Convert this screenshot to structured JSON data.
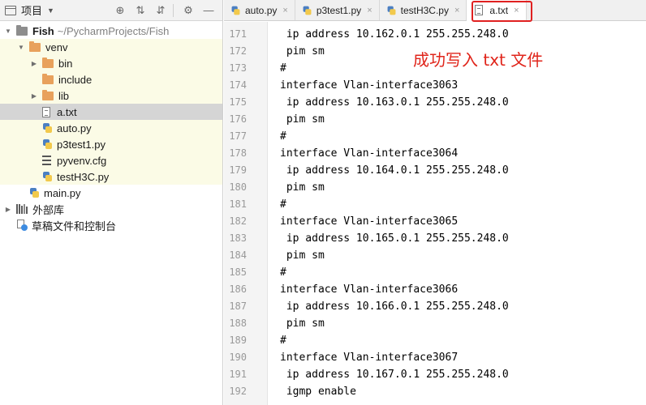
{
  "project_panel": {
    "title": "项目",
    "toolbar": {
      "locate_glyph": "⊕",
      "expand_glyph": "⇅",
      "collapse_glyph": "⇵",
      "settings_glyph": "⚙",
      "hide_glyph": "—"
    },
    "tree": {
      "root": {
        "name": "Fish",
        "path": "~/PycharmProjects/Fish"
      },
      "venv": "venv",
      "bin": "bin",
      "include": "include",
      "lib": "lib",
      "a_txt": "a.txt",
      "auto_py": "auto.py",
      "p3test1_py": "p3test1.py",
      "pyvenv_cfg": "pyvenv.cfg",
      "testh3c_py": "testH3C.py",
      "main_py": "main.py",
      "external_libs": "外部库",
      "scratches": "草稿文件和控制台"
    }
  },
  "editor": {
    "tabs": [
      {
        "label": "auto.py"
      },
      {
        "label": "p3test1.py"
      },
      {
        "label": "testH3C.py"
      },
      {
        "label": "a.txt",
        "active": true
      }
    ],
    "close_glyph": "×",
    "line_numbers": [
      "171",
      "172",
      "173",
      "174",
      "175",
      "176",
      "177",
      "178",
      "179",
      "180",
      "181",
      "182",
      "183",
      "184",
      "185",
      "186",
      "187",
      "188",
      "189",
      "190",
      "191",
      "192"
    ],
    "lines": [
      " ip address 10.162.0.1 255.255.248.0",
      " pim sm",
      "#",
      "interface Vlan-interface3063",
      " ip address 10.163.0.1 255.255.248.0",
      " pim sm",
      "#",
      "interface Vlan-interface3064",
      " ip address 10.164.0.1 255.255.248.0",
      " pim sm",
      "#",
      "interface Vlan-interface3065",
      " ip address 10.165.0.1 255.255.248.0",
      " pim sm",
      "#",
      "interface Vlan-interface3066",
      " ip address 10.166.0.1 255.255.248.0",
      " pim sm",
      "#",
      "interface Vlan-interface3067",
      " ip address 10.167.0.1 255.255.248.0",
      " igmp enable"
    ],
    "annotation": "成功写入 txt 文件",
    "annotation_color": "#e0251b"
  }
}
